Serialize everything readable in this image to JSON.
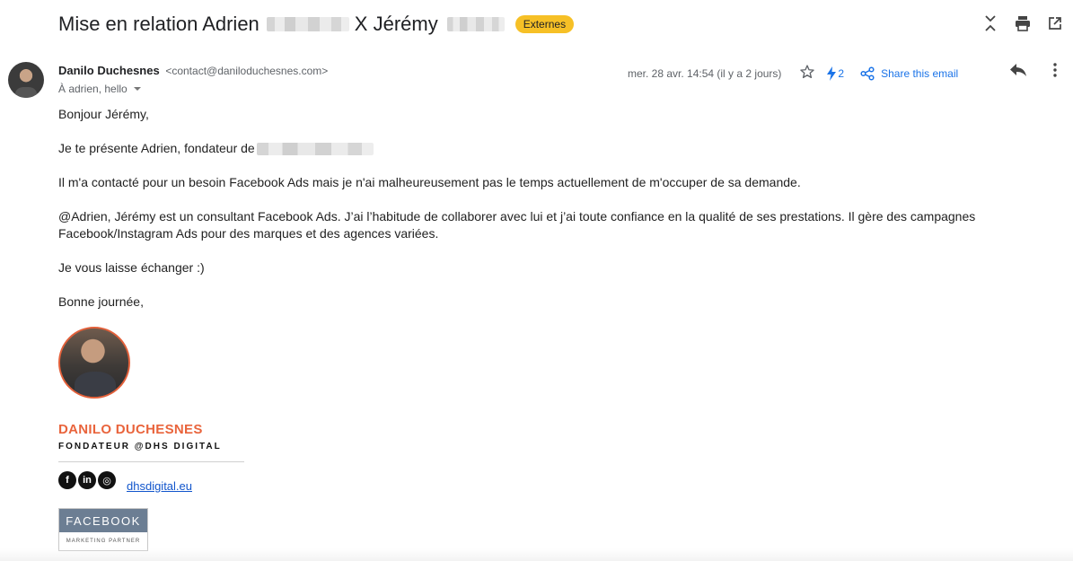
{
  "email": {
    "subject": {
      "part1": "Mise en relation Adrien",
      "part2": "X Jérémy",
      "badge": "Externes"
    },
    "sender": {
      "name": "Danilo Duchesnes",
      "email": "<contact@daniloduchesnes.com>"
    },
    "recipients": "À adrien, hello",
    "date": "mer. 28 avr. 14:54 (il y a 2 jours)",
    "bolt_count": "2",
    "share_label": "Share this email",
    "body": {
      "greeting": "Bonjour Jérémy,",
      "intro": "Je te présente Adrien, fondateur de",
      "p1": "Il m'a contacté pour un besoin Facebook Ads mais je n'ai malheureusement pas le temps actuellement de m'occuper de sa demande.",
      "p2": "@Adrien, Jérémy est un consultant Facebook Ads. J’ai l’habitude de collaborer avec lui et j’ai toute confiance en la qualité de ses prestations. Il gère des campagnes Facebook/Instagram Ads pour des marques et des agences variées.",
      "p3": "Je vous laisse échanger :)",
      "closing": "Bonne journée,"
    },
    "signature": {
      "name": "DANILO DUCHESNES",
      "title": "FONDATEUR @DHS DIGITAL",
      "socials": [
        {
          "icon": "facebook-icon",
          "glyph": "f"
        },
        {
          "icon": "linkedin-icon",
          "glyph": "in"
        },
        {
          "icon": "instagram-icon",
          "glyph": "◎"
        }
      ],
      "website": "dhsdigital.eu",
      "badge_top": "FACEBOOK",
      "badge_bottom": "MARKETING PARTNER"
    }
  },
  "colors": {
    "badge": "#f6c026",
    "link": "#1a73e8",
    "signature_accent": "#e9643c",
    "fb_badge": "#6c7e93"
  }
}
